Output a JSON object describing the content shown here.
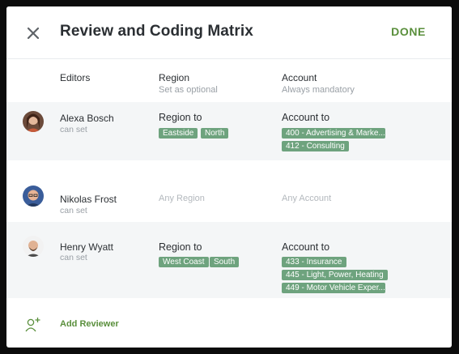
{
  "header": {
    "title": "Review and Coding Matrix",
    "done_label": "DONE"
  },
  "columns": {
    "editors": {
      "label": "Editors"
    },
    "region": {
      "label": "Region",
      "sub": "Set as optional"
    },
    "account": {
      "label": "Account",
      "sub": "Always mandatory"
    }
  },
  "reviewers": [
    {
      "name": "Alexa Bosch",
      "permission": "can set",
      "region_label": "Region to",
      "regions": [
        "Eastside",
        "North"
      ],
      "account_label": "Account to",
      "accounts": [
        "400 - Advertising & Marke...",
        "412 - Consulting"
      ]
    },
    {
      "name": "Nikolas Frost",
      "permission": "can set",
      "region_placeholder": "Any Region",
      "account_placeholder": "Any Account"
    },
    {
      "name": "Henry Wyatt",
      "permission": "can set",
      "region_label": "Region to",
      "regions": [
        "West Coast",
        "South"
      ],
      "account_label": "Account to",
      "accounts": [
        "433 - Insurance",
        "445 - Light, Power, Heating",
        "449 - Motor Vehicle Exper..."
      ]
    }
  ],
  "footer": {
    "add_label": "Add Reviewer"
  },
  "colors": {
    "accent": "#5a8f3c",
    "chip": "#6ea37e",
    "row_shade": "#f4f6f7"
  }
}
